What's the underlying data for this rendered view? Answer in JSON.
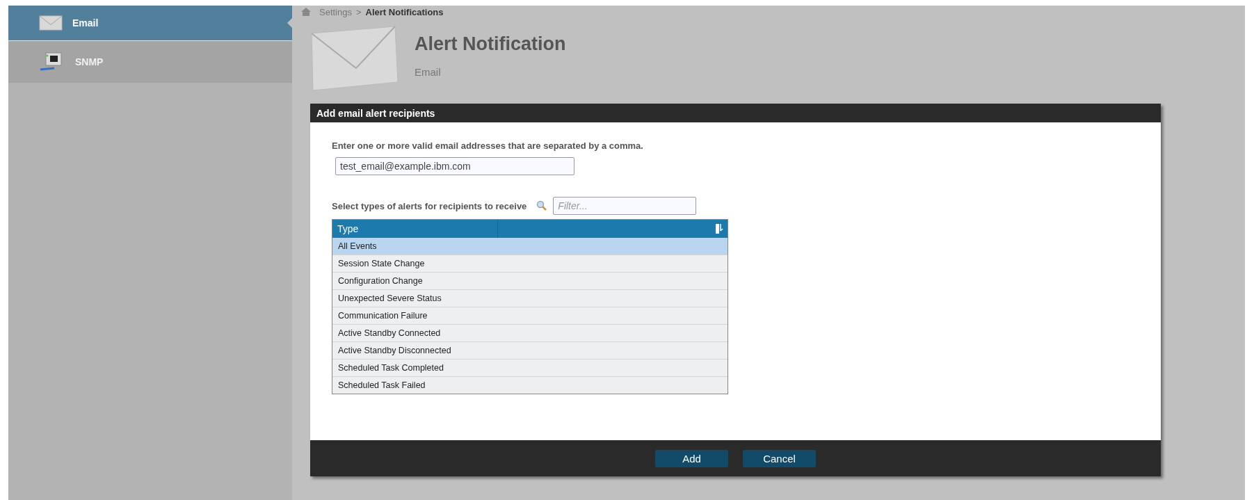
{
  "sidebar": {
    "items": [
      {
        "label": "Email",
        "selected": true
      },
      {
        "label": "SNMP",
        "selected": false
      }
    ]
  },
  "breadcrumb": {
    "items": [
      "Settings"
    ],
    "separator": ">",
    "current": "Alert Notifications"
  },
  "header": {
    "title": "Alert Notification",
    "subtitle": "Email"
  },
  "dialog": {
    "title": "Add email alert recipients",
    "instruction": "Enter one or more valid email addresses that are separated by a comma.",
    "email_field": {
      "value": "test_email@example.ibm.com"
    },
    "types_label": "Select types of alerts for recipients to receive",
    "filter": {
      "placeholder": "Filter..."
    },
    "table": {
      "columns": [
        "Type"
      ],
      "rows": [
        {
          "type": "All Events",
          "selected": true
        },
        {
          "type": "Session State Change",
          "selected": false
        },
        {
          "type": "Configuration Change",
          "selected": false
        },
        {
          "type": "Unexpected Severe Status",
          "selected": false
        },
        {
          "type": "Communication Failure",
          "selected": false
        },
        {
          "type": "Active Standby Connected",
          "selected": false
        },
        {
          "type": "Active Standby Disconnected",
          "selected": false
        },
        {
          "type": "Scheduled Task Completed",
          "selected": false
        },
        {
          "type": "Scheduled Task Failed",
          "selected": false
        }
      ]
    },
    "buttons": [
      "Add",
      "Cancel"
    ]
  }
}
